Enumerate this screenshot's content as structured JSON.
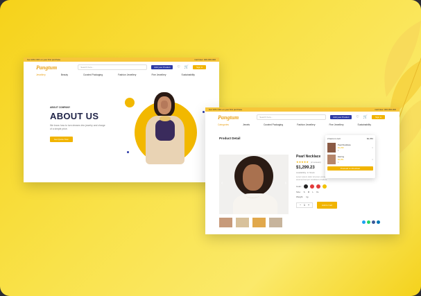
{
  "shot1": {
    "topbar_left": "Get 10% OFF on your first purchase",
    "topbar_right": "Call Now: 000-000-000",
    "logo": "Pangtum",
    "search_placeholder": "Search here...",
    "add_product": "Add your Product",
    "signin": "Sign in",
    "nav": [
      "Jewellery",
      "Beauty",
      "Curated Packaging",
      "Fashion Jewellery",
      "Fine Jewellery",
      "Sustainability"
    ],
    "about_small": "ABOUT COMPANY",
    "about_title": "ABOUT US",
    "about_desc": "We know how to turn dreams into jewelry and charge of a simple price.",
    "about_btn": "Get Quote Now"
  },
  "shot2": {
    "topbar_left": "Get 10% OFF on your first purchase",
    "topbar_right": "Call Now: 000-000-000",
    "logo": "Pangtum",
    "search_placeholder": "Search here...",
    "add_product": "Add your Product",
    "signin": "Sign in",
    "nav": [
      "Categories",
      "Jewels",
      "Curated Packaging",
      "Fashion Jewellery",
      "Fine Jewellery",
      "Sustainability"
    ],
    "page_title": "Product Detail",
    "product_name": "Pearl Necklace",
    "reviews": "(2 reviews)",
    "price": "$1,299.23",
    "availability": "Availability: In Stock",
    "desc": "Lorem ipsum dolor sit amet, consectetur adipiscing elit sed do eiusmod tempor incididunt ut labore.",
    "color_label": "Color:",
    "size_label": "Size:",
    "sizes": [
      "S",
      "M",
      "L",
      "XL"
    ],
    "weight_label": "Weight:",
    "weight_value": "1g",
    "qty": "1",
    "add_cart": "Add to Cart",
    "cart_title": "2 items in cart",
    "cart_total": "$4,350",
    "cart_items": [
      {
        "name": "Pearl Necklace",
        "price": "$1,299",
        "qty": "1"
      },
      {
        "name": "Earring",
        "price": "$3,051",
        "qty": "1"
      }
    ],
    "checkout": "Proceed to Checkout",
    "swatches": [
      "#222222",
      "#e23b3b",
      "#e23b3b",
      "#f2c200"
    ],
    "share_colors": [
      "#1da1f2",
      "#25d366",
      "#3b5998",
      "#0077b5"
    ]
  }
}
